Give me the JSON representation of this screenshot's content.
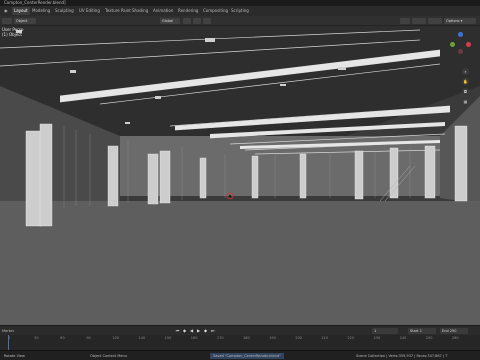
{
  "window": {
    "title": "Compton_CenterRender.blend]"
  },
  "menubar": {
    "items": [
      "Layout",
      "Modeling",
      "Sculpting",
      "UV Editing",
      "Texture Paint",
      "Shading",
      "Animation",
      "Rendering",
      "Compositing",
      "Scripting"
    ],
    "active": "Layout"
  },
  "header": {
    "view_mode": "Object",
    "orientation": "Global",
    "options_label": "Options ▾"
  },
  "viewport": {
    "overlay_label": "User Persp",
    "sub_label": "(1) Object"
  },
  "navgizmo": {
    "axis_colors": {
      "x": "#e03a4a",
      "y": "#6aa52a",
      "z": "#3b74d8"
    },
    "icons": [
      "zoom-icon",
      "hand-icon",
      "camera-icon",
      "grid-icon"
    ]
  },
  "timeline": {
    "marker_label": "Marker",
    "ticks": [
      "0",
      "30",
      "60",
      "90",
      "120",
      "140",
      "150",
      "160",
      "170",
      "180",
      "190",
      "200",
      "210",
      "220",
      "230",
      "240",
      "250",
      "260"
    ],
    "current_frame": "1",
    "start_label": "Start",
    "start_value": "1",
    "end_label": "End",
    "end_value": "250"
  },
  "statusbar": {
    "left": "Rotate View",
    "mid": "Object Context Menu",
    "notice": "Saved \"Compton_CenterRender.blend\"",
    "right": "Scene Collection | Verts:359,937 | Faces:347,867 | T"
  },
  "colors": {
    "accent": "#4772b3",
    "bg": "#1d1d1d",
    "floor": "#5e5e5e"
  }
}
